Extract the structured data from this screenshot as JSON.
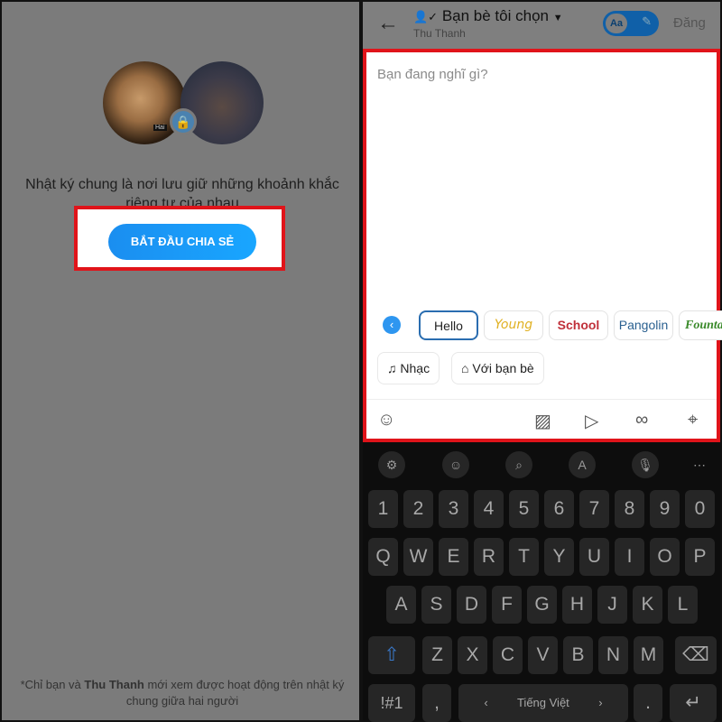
{
  "left": {
    "avatar_tag": "Hai",
    "description": "Nhật ký chung là nơi lưu giữ những khoảnh khắc riêng tư của nhau",
    "start_button": "BẮT ĐẦU CHIA SẺ",
    "note_prefix": "*Chỉ bạn và ",
    "note_name": "Thu Thanh",
    "note_suffix": " mới xem được hoạt động trên nhật ký chung giữa hai người"
  },
  "header": {
    "audience": "Bạn bè tôi chọn",
    "subtitle": "Thu Thanh",
    "toggle_label": "Aa",
    "post_button": "Đăng"
  },
  "composer": {
    "placeholder": "Bạn đang nghĩ gì?",
    "styles": [
      "Hello",
      "Young",
      "School",
      "Pangolin",
      "Founta"
    ],
    "music": "Nhạc",
    "tag_friends": "Với bạn bè"
  },
  "keyboard": {
    "rows": [
      [
        "1",
        "2",
        "3",
        "4",
        "5",
        "6",
        "7",
        "8",
        "9",
        "0"
      ],
      [
        "Q",
        "W",
        "E",
        "R",
        "T",
        "Y",
        "U",
        "I",
        "O",
        "P"
      ],
      [
        "A",
        "S",
        "D",
        "F",
        "G",
        "H",
        "J",
        "K",
        "L"
      ],
      [
        "Z",
        "X",
        "C",
        "V",
        "B",
        "N",
        "M"
      ]
    ],
    "symbols": "!#1",
    "comma": ",",
    "space": "Tiếng Việt",
    "period": "."
  },
  "colors": {
    "accent": "#1a8ef0",
    "highlight": "#e0141a"
  }
}
